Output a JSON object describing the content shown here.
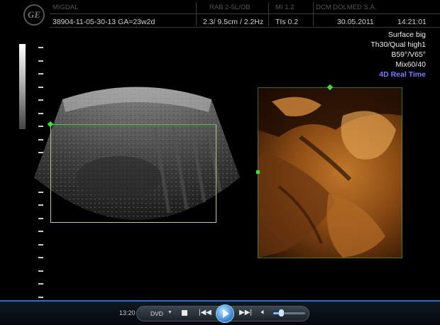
{
  "header": {
    "logo_text": "GE",
    "row1": {
      "hospital": "MIGDAL",
      "probe": "RAB 2-5L/OB",
      "mi": "MI 1.2",
      "institution": "DCM DOLMED S.A."
    },
    "row2": {
      "patient": "38904-11-05-30-13 GA=23w2d",
      "depth_freq": "2.3/ 9.5cm / 2.2Hz",
      "tis": "TIs 0.2",
      "date": "30.05.2011",
      "time": "14:21:01"
    }
  },
  "params": {
    "surface": "Surface big",
    "quality": "Th30/Qual high1",
    "angles": "B59°/V65°",
    "mix": "Mix60/40",
    "mode": "4D Real Time"
  },
  "player": {
    "elapsed": "13:20",
    "source": "DVD",
    "volume_fraction": 0.25
  },
  "colors": {
    "mode_text": "#7b7bff",
    "roi_box": "#c8c896",
    "markers": "#3ee03e",
    "progress_bar": "#2b6fc0"
  }
}
